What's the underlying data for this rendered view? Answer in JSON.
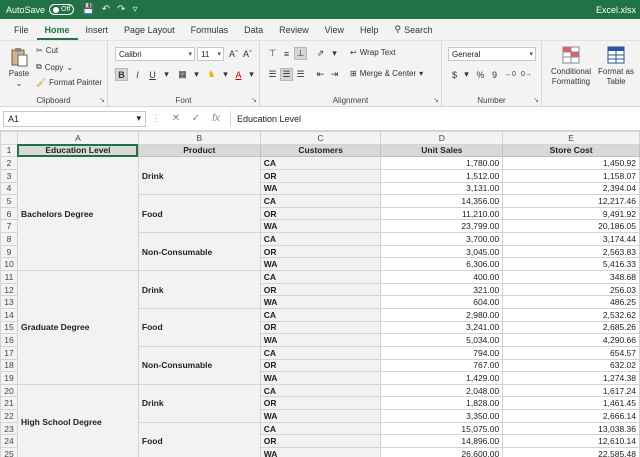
{
  "titlebar": {
    "autosave_label": "AutoSave",
    "autosave_state": "Off",
    "filename": "Excel.xlsx"
  },
  "tabs": [
    "File",
    "Home",
    "Insert",
    "Page Layout",
    "Formulas",
    "Data",
    "Review",
    "View",
    "Help"
  ],
  "search_label": "Search",
  "ribbon": {
    "clipboard": {
      "paste": "Paste",
      "cut": "Cut",
      "copy": "Copy",
      "format_painter": "Format Painter",
      "label": "Clipboard"
    },
    "font": {
      "name": "Calibri",
      "size": "11",
      "label": "Font"
    },
    "alignment": {
      "wrap_text": "Wrap Text",
      "merge_center": "Merge & Center",
      "label": "Alignment"
    },
    "number": {
      "format": "General",
      "label": "Number"
    },
    "styles": {
      "conditional": "Conditional Formatting",
      "format_table": "Format as Table"
    }
  },
  "formula_bar": {
    "name_box": "A1",
    "content": "Education Level"
  },
  "columns": [
    "A",
    "B",
    "C",
    "D",
    "E"
  ],
  "headers": [
    "Education Level",
    "Product",
    "Customers",
    "Unit Sales",
    "Store Cost"
  ],
  "rows": [
    {
      "n": "2",
      "edu": "Bachelors Degree",
      "edu_span": 9,
      "prod": "Drink",
      "prod_span": 3,
      "cust": "CA",
      "units": "1,780.00",
      "cost": "1,450.92"
    },
    {
      "n": "3",
      "cust": "OR",
      "units": "1,512.00",
      "cost": "1,158.07"
    },
    {
      "n": "4",
      "cust": "WA",
      "units": "3,131.00",
      "cost": "2,394.04"
    },
    {
      "n": "5",
      "prod": "Food",
      "prod_span": 3,
      "cust": "CA",
      "units": "14,356.00",
      "cost": "12,217.46"
    },
    {
      "n": "6",
      "cust": "OR",
      "units": "11,210.00",
      "cost": "9,491.92"
    },
    {
      "n": "7",
      "cust": "WA",
      "units": "23,799.00",
      "cost": "20,186.05"
    },
    {
      "n": "8",
      "prod": "Non-Consumable",
      "prod_span": 3,
      "cust": "CA",
      "units": "3,700.00",
      "cost": "3,174.44"
    },
    {
      "n": "9",
      "cust": "OR",
      "units": "3,045.00",
      "cost": "2,563.83"
    },
    {
      "n": "10",
      "cust": "WA",
      "units": "6,306.00",
      "cost": "5,416.33"
    },
    {
      "n": "11",
      "edu": "Graduate Degree",
      "edu_span": 9,
      "prod": "Drink",
      "prod_span": 3,
      "cust": "CA",
      "units": "400.00",
      "cost": "348.68"
    },
    {
      "n": "12",
      "cust": "OR",
      "units": "321.00",
      "cost": "256.03"
    },
    {
      "n": "13",
      "cust": "WA",
      "units": "604.00",
      "cost": "486.25"
    },
    {
      "n": "14",
      "prod": "Food",
      "prod_span": 3,
      "cust": "CA",
      "units": "2,980.00",
      "cost": "2,532.62"
    },
    {
      "n": "15",
      "cust": "OR",
      "units": "3,241.00",
      "cost": "2,685.26"
    },
    {
      "n": "16",
      "cust": "WA",
      "units": "5,034.00",
      "cost": "4,290.66"
    },
    {
      "n": "17",
      "prod": "Non-Consumable",
      "prod_span": 3,
      "cust": "CA",
      "units": "794.00",
      "cost": "654.57"
    },
    {
      "n": "18",
      "cust": "OR",
      "units": "767.00",
      "cost": "632.02"
    },
    {
      "n": "19",
      "cust": "WA",
      "units": "1,429.00",
      "cost": "1,274.38"
    },
    {
      "n": "20",
      "edu": "High School Degree",
      "edu_span": 6,
      "prod": "Drink",
      "prod_span": 3,
      "cust": "CA",
      "units": "2,048.00",
      "cost": "1,617.24"
    },
    {
      "n": "21",
      "cust": "OR",
      "units": "1,828.00",
      "cost": "1,461.45"
    },
    {
      "n": "22",
      "cust": "WA",
      "units": "3,350.00",
      "cost": "2,666.14"
    },
    {
      "n": "23",
      "prod": "Food",
      "prod_span": 3,
      "cust": "CA",
      "units": "15,075.00",
      "cost": "13,038.36"
    },
    {
      "n": "24",
      "cust": "OR",
      "units": "14,896.00",
      "cost": "12,610.14"
    },
    {
      "n": "25",
      "cust": "WA",
      "units": "26,600.00",
      "cost": "22,585.48"
    }
  ]
}
